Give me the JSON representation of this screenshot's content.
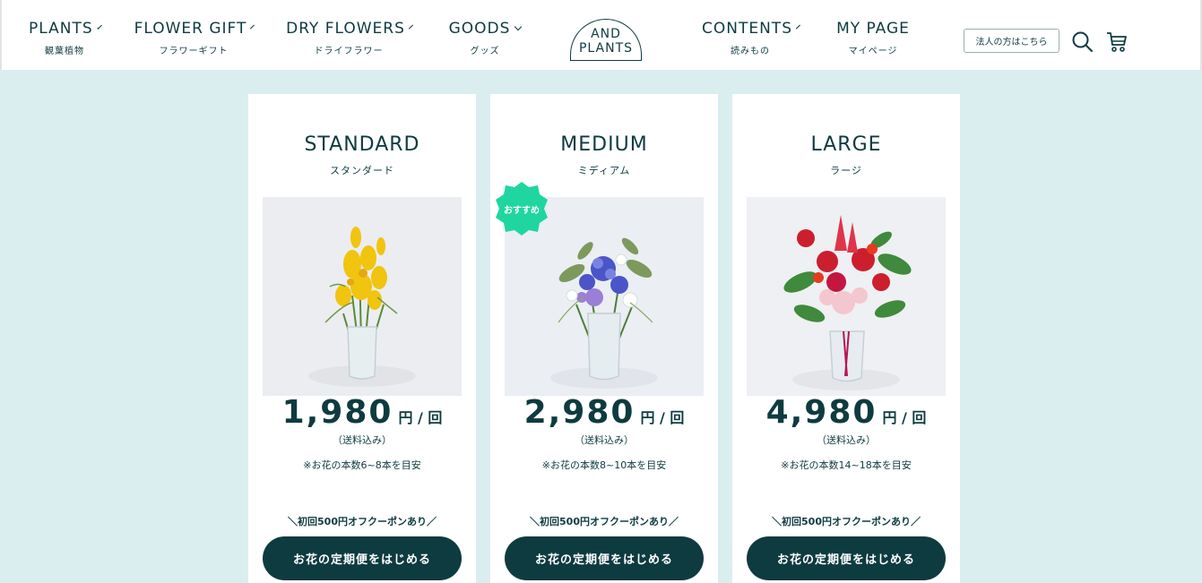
{
  "nav": [
    {
      "label": "PLANTS",
      "sub": "観葉植物"
    },
    {
      "label": "FLOWER GIFT",
      "sub": "フラワーギフト"
    },
    {
      "label": "DRY FLOWERS",
      "sub": "ドライフラワー"
    },
    {
      "label": "GOODS",
      "sub": "グッズ"
    },
    {
      "label": "CONTENTS",
      "sub": "読みもの"
    },
    {
      "label": "MY PAGE",
      "sub": "マイページ"
    }
  ],
  "logo": {
    "line1": "AND",
    "line2": "PLANTS"
  },
  "header": {
    "corporate_button": "法人の方はこちら"
  },
  "icons": {
    "search": "search-icon",
    "cart": "cart-icon"
  },
  "badge": "おすすめ",
  "plans": [
    {
      "title": "STANDARD",
      "subtitle": "スタンダード",
      "price": "1,980",
      "unit": "円 / 回",
      "tax": "（送料込み）",
      "note": "※お花の本数6~8本を目安",
      "coupon": "＼初回500円オフクーポンあり／",
      "cta": "お花の定期便をはじめる"
    },
    {
      "title": "MEDIUM",
      "subtitle": "ミディアム",
      "price": "2,980",
      "unit": "円 / 回",
      "tax": "（送料込み）",
      "note": "※お花の本数8~10本を目安",
      "coupon": "＼初回500円オフクーポンあり／",
      "cta": "お花の定期便をはじめる"
    },
    {
      "title": "LARGE",
      "subtitle": "ラージ",
      "price": "4,980",
      "unit": "円 / 回",
      "tax": "（送料込み）",
      "note": "※お花の本数14~18本を目安",
      "coupon": "＼初回500円オフクーポンあり／",
      "cta": "お花の定期便をはじめる"
    }
  ],
  "colors": {
    "brand": "#0e3b40",
    "background": "#dbeeef",
    "badge": "#1fd6a0"
  }
}
